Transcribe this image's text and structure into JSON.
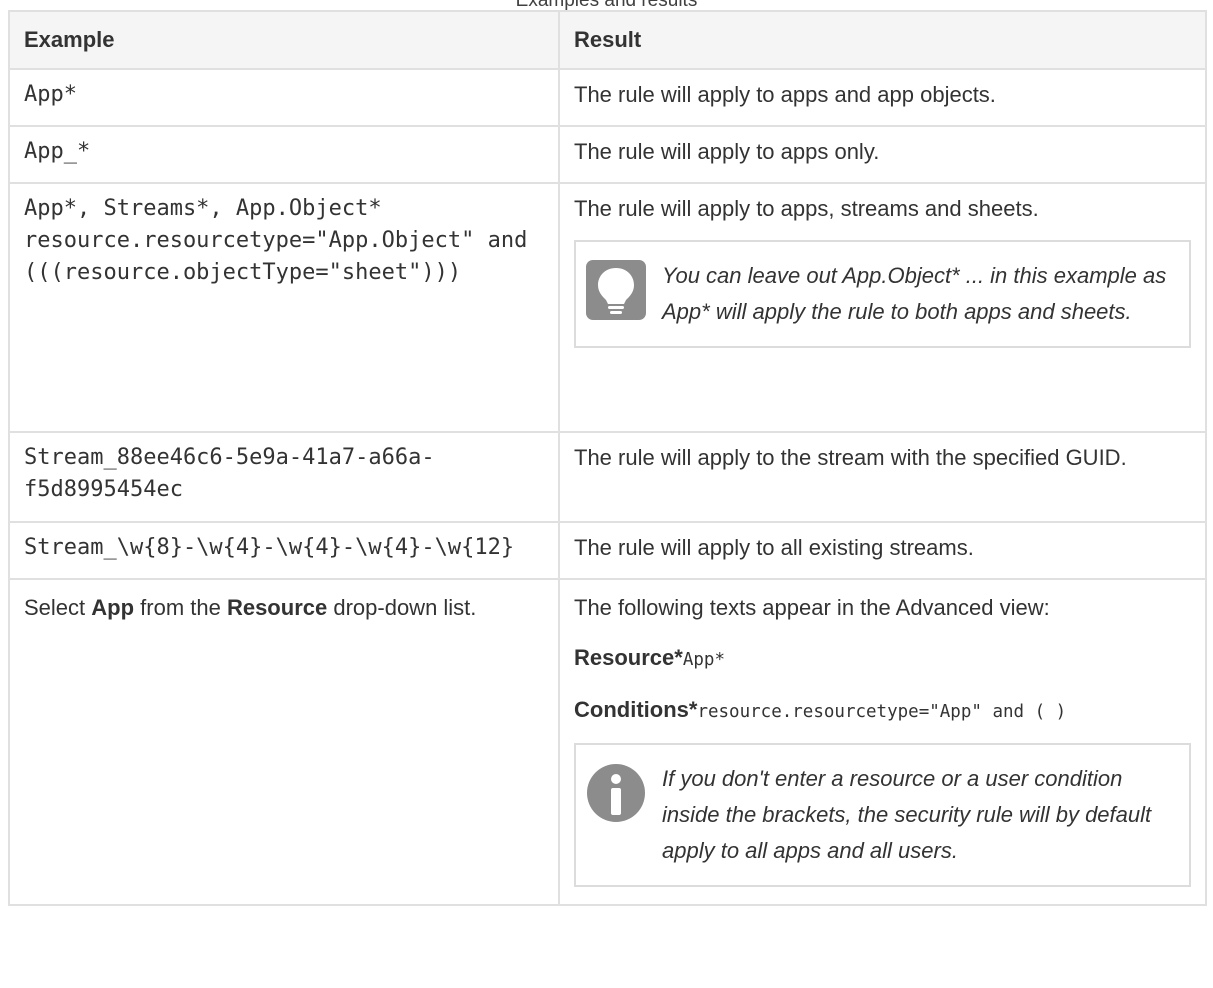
{
  "caption": "Examples and results",
  "table": {
    "headers": {
      "example": "Example",
      "result": "Result"
    },
    "rows": [
      {
        "example_code": [
          "App*"
        ],
        "result": "The rule will apply to apps and app objects."
      },
      {
        "example_code": [
          "App_*"
        ],
        "result": "The rule will apply to apps only."
      },
      {
        "example_code": [
          "App*, Streams*, App.Object*",
          "resource.resourcetype=\"App.Object\" and",
          "(((resource.objectType=\"sheet\")))"
        ],
        "result": "The rule will apply to apps, streams and sheets.",
        "note": {
          "icon": "lightbulb-icon",
          "text": "You can leave out App.Object* ... in this example as App* will apply the rule to both apps and sheets."
        }
      },
      {
        "example_code": [
          "Stream_88ee46c6-5e9a-41a7-a66a-",
          "f5d8995454ec"
        ],
        "result": "The rule will apply to the stream with the specified GUID."
      },
      {
        "example_code": [
          "Stream_\\w{8}-\\w{4}-\\w{4}-\\w{4}-\\w{12}"
        ],
        "result": "The rule will apply to all existing streams."
      },
      {
        "example_parts": {
          "a": "Select ",
          "b": "App",
          "c": " from the ",
          "d": "Resource",
          "e": " drop-down list."
        },
        "result": "The following texts appear in the Advanced view:",
        "resource_label": "Resource*",
        "resource_value": "App*",
        "conditions_label": "Conditions*",
        "conditions_value": "resource.resourcetype=\"App\" and ( )",
        "note": {
          "icon": "info-icon",
          "text": "If you don't enter a resource or a user condition inside the brackets, the security rule will by default apply to all apps and all users."
        }
      }
    ]
  },
  "colors": {
    "border": "#e0e0e0",
    "header_bg": "#f5f5f5",
    "icon_gray": "#8c8c8c",
    "text": "#333333"
  }
}
